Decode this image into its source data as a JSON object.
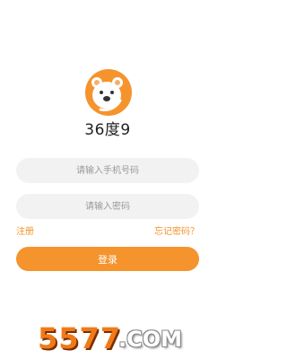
{
  "app": {
    "title": "36度9",
    "logo_icon": "bear-logo-icon"
  },
  "form": {
    "phone_placeholder": "请输入手机号码",
    "password_placeholder": "请输入密码",
    "register_label": "注册",
    "forgot_label": "忘记密码？",
    "login_label": "登录"
  },
  "watermark": {
    "number": "5577",
    "domain": ".COM"
  },
  "colors": {
    "accent": "#f5932d",
    "field_bg": "#f2f2f2",
    "background": "#ffffff"
  }
}
